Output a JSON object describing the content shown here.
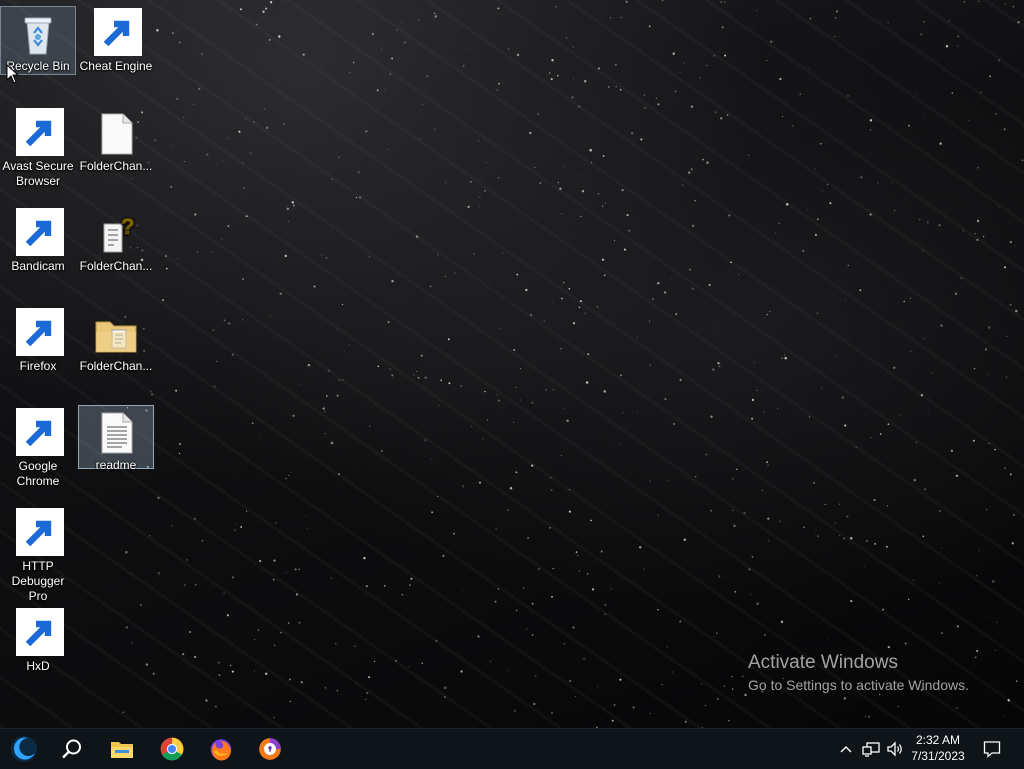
{
  "desktop": {
    "icons": [
      {
        "id": "recycle-bin",
        "label": "Recycle Bin"
      },
      {
        "id": "cheat-engine",
        "label": "Cheat Engine"
      },
      {
        "id": "avast",
        "label": "Avast Secure Browser"
      },
      {
        "id": "folderchan-1",
        "label": "FolderChan..."
      },
      {
        "id": "bandicam",
        "label": "Bandicam"
      },
      {
        "id": "folderchan-2",
        "label": "FolderChan..."
      },
      {
        "id": "firefox",
        "label": "Firefox"
      },
      {
        "id": "folderchan-3",
        "label": "FolderChan..."
      },
      {
        "id": "chrome",
        "label": "Google Chrome"
      },
      {
        "id": "readme",
        "label": "readme"
      },
      {
        "id": "http-debugger",
        "label": "HTTP Debugger Pro"
      },
      {
        "id": "hxd",
        "label": "HxD"
      }
    ]
  },
  "watermark": {
    "title": "Activate Windows",
    "subtitle": "Go to Settings to activate Windows."
  },
  "taskbar": {
    "items": [
      "start-icon",
      "search-icon",
      "file-explorer-icon",
      "chrome-icon",
      "firefox-icon",
      "avast-browser-icon"
    ],
    "tray": {
      "icons": [
        "chevron-up-icon",
        "network-icon",
        "volume-icon"
      ],
      "time": "2:32 AM",
      "date": "7/31/2023",
      "notification_icon": "notification-icon"
    }
  },
  "colors": {
    "taskbar_bg": "#0f1418",
    "start_accent": "#2fa3ff",
    "selection": "#9fb4c8"
  }
}
